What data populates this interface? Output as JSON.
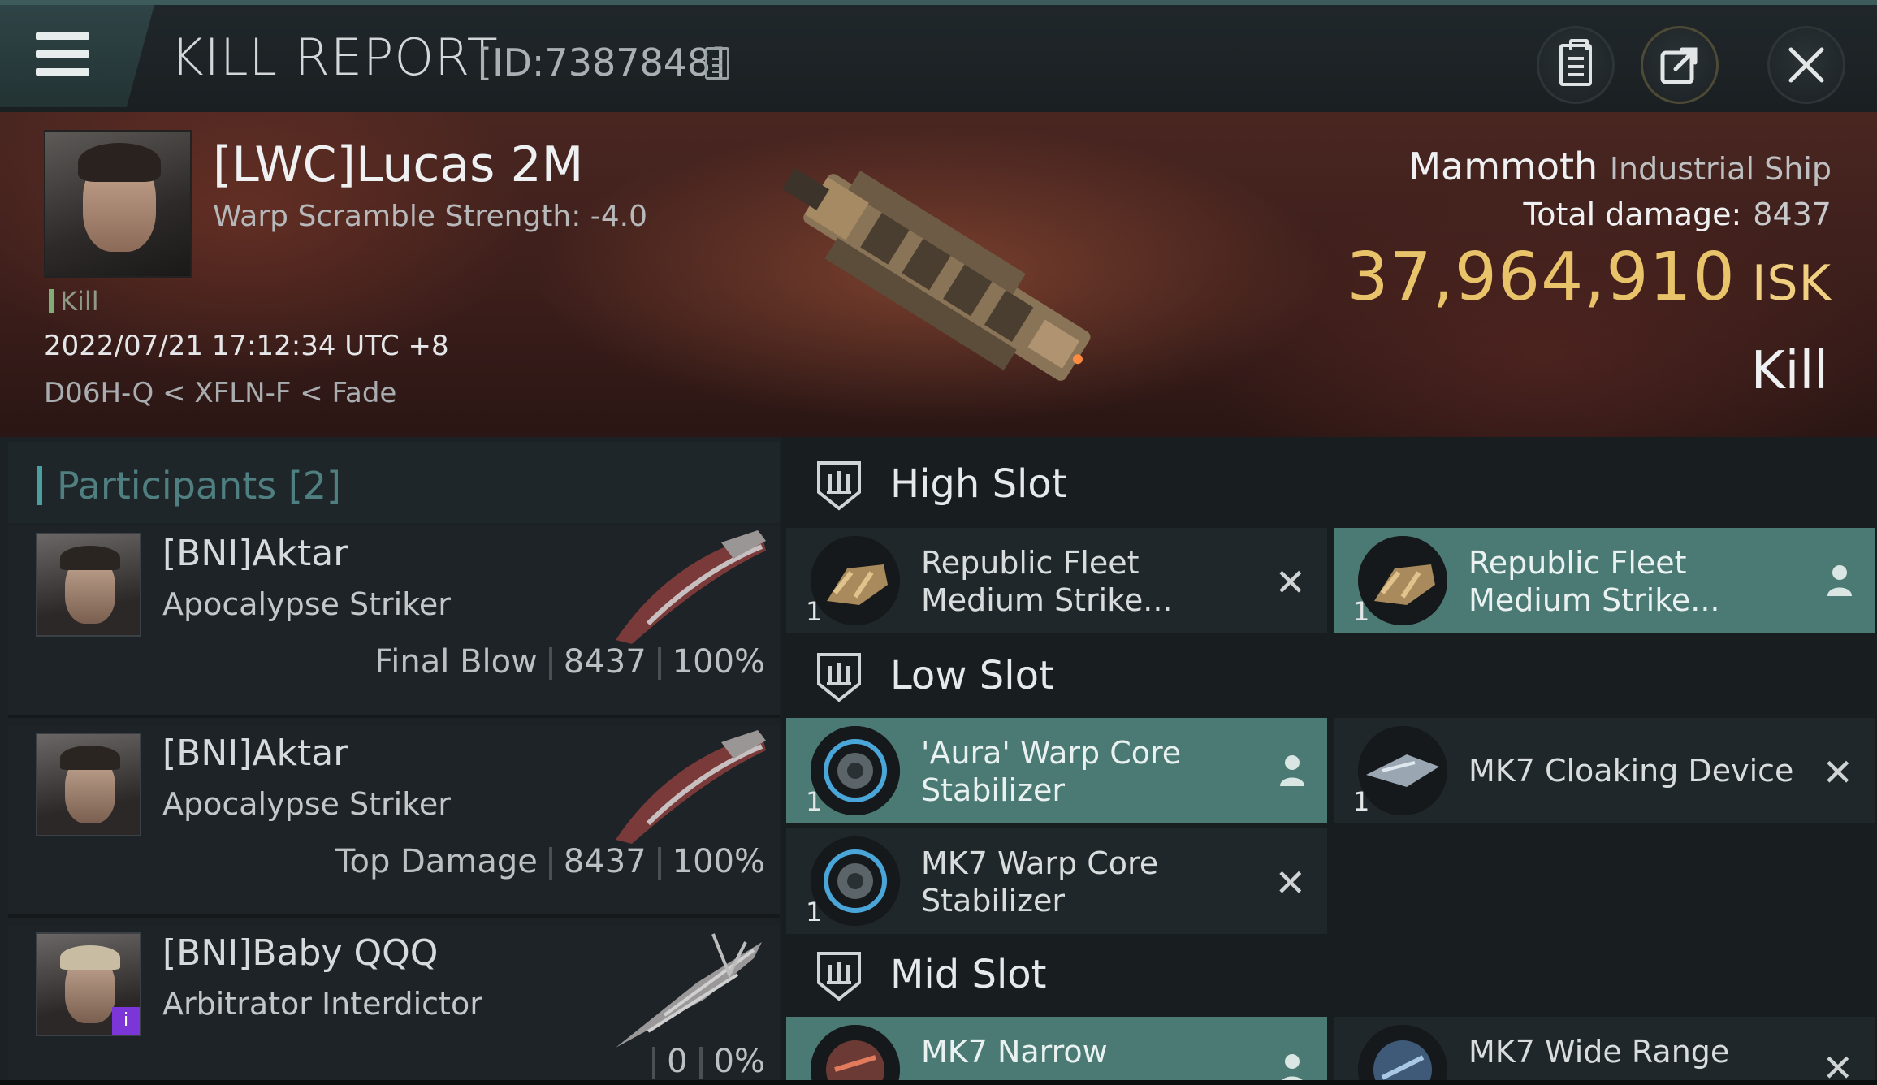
{
  "topbar": {
    "title": "KILL REPORT",
    "report_id": "[ID:7387848]"
  },
  "victim": {
    "name": "[LWC]Lucas 2M",
    "warp_scramble": "Warp Scramble Strength: -4.0",
    "kill_tag": "Kill",
    "timestamp": "2022/07/21 17:12:34 UTC +8",
    "location": "D06H-Q < XFLN-F < Fade",
    "ship_name": "Mammoth",
    "ship_class": "Industrial Ship",
    "total_damage_label": "Total damage:",
    "total_damage_value": "8437",
    "isk_value": "37,964,910",
    "isk_unit": "ISK",
    "result": "Kill"
  },
  "participants": {
    "title": "Participants",
    "count": "[2]",
    "rows": [
      {
        "name": "[BNI]Aktar",
        "ship": "Apocalypse Striker",
        "role": "Final Blow",
        "damage": "8437",
        "percent": "100%"
      },
      {
        "name": "[BNI]Aktar",
        "ship": "Apocalypse Striker",
        "role": "Top Damage",
        "damage": "8437",
        "percent": "100%"
      },
      {
        "name": "[BNI]Baby QQQ",
        "ship": "Arbitrator Interdictor",
        "role": "",
        "damage": "0",
        "percent": "0%",
        "badge": "i"
      }
    ]
  },
  "slots": {
    "high": {
      "title": "High Slot",
      "items": [
        {
          "name": "Republic Fleet Medium Strike...",
          "qty": "1",
          "status": "destroyed"
        },
        {
          "name": "Republic Fleet Medium Strike...",
          "qty": "1",
          "status": "dropped"
        }
      ]
    },
    "low": {
      "title": "Low Slot",
      "items": [
        {
          "name": "'Aura' Warp Core Stabilizer",
          "qty": "1",
          "status": "dropped"
        },
        {
          "name": "MK7 Cloaking Device",
          "qty": "1",
          "status": "destroyed"
        },
        {
          "name": "MK7 Warp Core Stabilizer",
          "qty": "1",
          "status": "destroyed"
        }
      ]
    },
    "mid": {
      "title": "Mid Slot",
      "items": [
        {
          "name": "MK7 Narrow",
          "qty": "",
          "status": "dropped"
        },
        {
          "name": "MK7 Wide Range",
          "qty": "",
          "status": "destroyed"
        }
      ]
    }
  },
  "icons": {
    "destroyed": "close-icon",
    "dropped": "person-icon"
  },
  "colors": {
    "isk": "#e9c36a",
    "dropped_bg": "#4b7a74",
    "accent": "#4aa0a0"
  }
}
